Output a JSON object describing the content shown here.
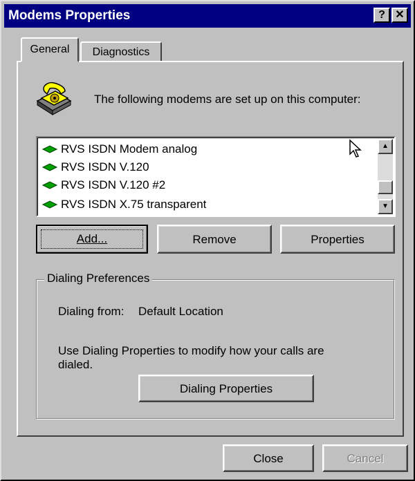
{
  "window": {
    "title": "Modems Properties",
    "help_button": "?",
    "close_button": "✕"
  },
  "tabs": [
    {
      "label": "General",
      "active": true
    },
    {
      "label": "Diagnostics",
      "active": false
    }
  ],
  "intro_text": "The following modems are set up on this computer:",
  "icon": "telephone-icon",
  "modems": [
    "RVS ISDN Modem analog",
    "RVS ISDN V.120",
    "RVS ISDN V.120 #2",
    "RVS ISDN X.75 transparent"
  ],
  "buttons": {
    "add": "Add...",
    "remove": "Remove",
    "properties": "Properties",
    "dialing_properties": "Dialing Properties",
    "close": "Close",
    "cancel": "Cancel"
  },
  "dialing": {
    "group_label": "Dialing Preferences",
    "dialing_from_label": "Dialing from:",
    "dialing_from_value": "Default Location",
    "help_text_line1": "Use Dialing Properties to modify how your calls are",
    "help_text_line2": "dialed."
  },
  "colors": {
    "titlebar": "#000080",
    "face": "#c0c0c0",
    "disabled_text": "#808080"
  }
}
